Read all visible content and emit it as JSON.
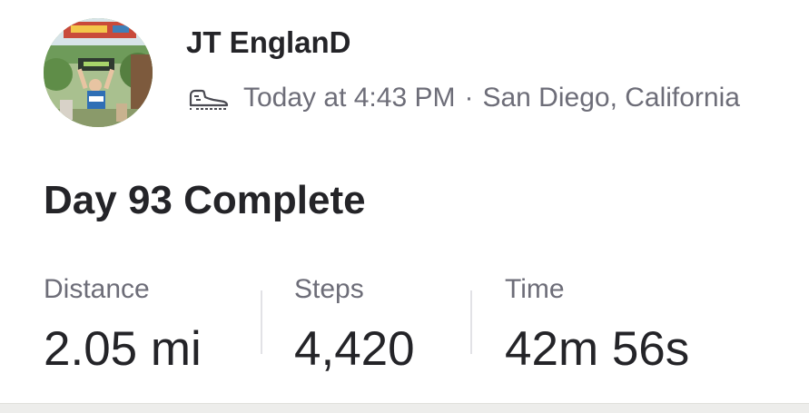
{
  "activity": {
    "athlete": {
      "name": "JT EnglanD"
    },
    "icons": {
      "activity_type": "shoe-icon"
    },
    "meta": {
      "time": "Today at 4:43 PM",
      "separator": "·",
      "location": "San Diego, California"
    },
    "title": "Day 93 Complete",
    "stats": [
      {
        "label": "Distance",
        "value": "2.05 mi"
      },
      {
        "label": "Steps",
        "value": "4,420"
      },
      {
        "label": "Time",
        "value": "42m 56s"
      }
    ]
  },
  "colors": {
    "text_primary": "#242428",
    "text_secondary": "#6d6d78",
    "divider": "#e2e2e6",
    "background": "#ffffff"
  }
}
